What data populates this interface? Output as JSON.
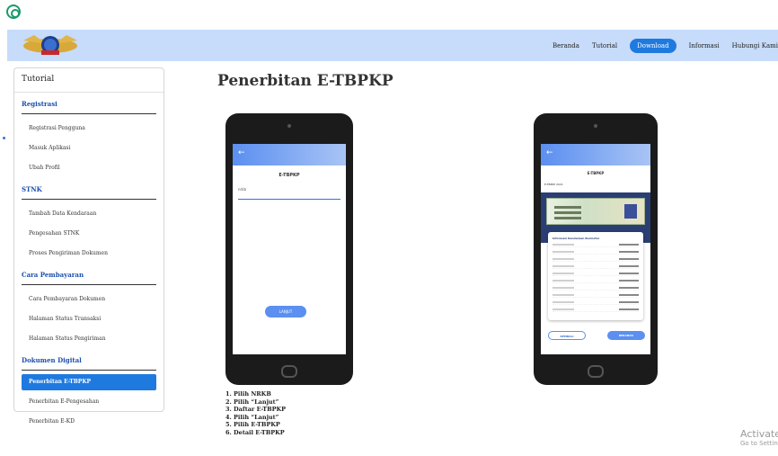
{
  "navbar": {
    "links": [
      "Beranda",
      "Tutorial",
      "Download",
      "Informasi",
      "Hubungi Kami"
    ],
    "active": "Download",
    "accent_color": "#1f7ae0",
    "background_color": "#c6dcfa"
  },
  "sidebar": {
    "title": "Tutorial",
    "sections": [
      {
        "heading": "Registrasi",
        "items": [
          "Registrasi Pengguna",
          "Masuk Aplikasi",
          "Ubah Profil"
        ]
      },
      {
        "heading": "STNK",
        "items": [
          "Tambah Data Kendaraan",
          "Pengesahan STNK",
          "Proses Pengiriman Dokumen"
        ]
      },
      {
        "heading": "Cara Pembayaran",
        "items": [
          "Cara Pembayaran Dokumen",
          "Halaman Status Transaksi",
          "Halaman Status Pengiriman"
        ]
      },
      {
        "heading": "Dokumen Digital",
        "items": [
          "Penerbitan E-TBPKP",
          "Penerbitan E-Pengesahan",
          "Penerbitan E-KD"
        ]
      }
    ],
    "active_item": "Penerbitan E-TBPKP"
  },
  "main": {
    "title": "Penerbitan E-TBPKP",
    "phone1": {
      "back_icon": "arrow-left-icon",
      "app_title": "E-TBPKP",
      "field_label": "nrkb",
      "button": "LANJUT"
    },
    "phone2": {
      "app_title": "E-TBPKP",
      "subtitle": "E-TBPKP 2021",
      "card_title": "Informasi Kendaraan Bermotor",
      "btn_back": "KEMBALI",
      "btn_home": "BERANDA"
    },
    "steps": [
      "1. Pilih NRKB",
      "2. Pilih “Lanjut”",
      "3. Daftar E-TBPKP",
      "4. Pilih “Lanjut”",
      "5. Pilih E-TBPKP",
      "6. Detail E-TBPKP"
    ]
  },
  "watermark": {
    "line1": "Activate Windows",
    "line2": "Go to Settings to activate Windows."
  }
}
